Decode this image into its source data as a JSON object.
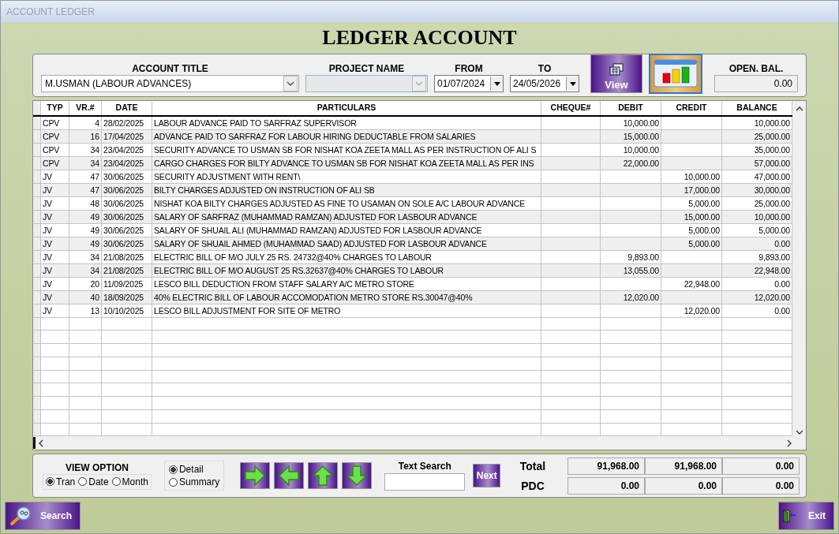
{
  "window": {
    "title": "ACCOUNT LEDGER"
  },
  "heading": "LEDGER ACCOUNT",
  "filters": {
    "account_title": {
      "label": "ACCOUNT TITLE",
      "value": "M.USMAN (LABOUR ADVANCES)"
    },
    "project_name": {
      "label": "PROJECT NAME",
      "disabled": true
    },
    "from": {
      "label": "FROM",
      "value": "01/07/2024"
    },
    "to": {
      "label": "TO",
      "value": "24/05/2026"
    },
    "view_button": "View",
    "opening_balance": {
      "label": "OPEN. BAL.",
      "value": "0.00"
    }
  },
  "table": {
    "columns": [
      "TYP",
      "VR.#",
      "DATE",
      "PARTICULARS",
      "CHEQUE#",
      "DEBIT",
      "CREDIT",
      "BALANCE"
    ],
    "rows": [
      {
        "typ": "CPV",
        "vr": "4",
        "date": "28/02/2025",
        "particulars": "LABOUR ADVANCE PAID TO SARFRAZ SUPERVISOR",
        "debit": "10,000.00",
        "balance": "10,000.00"
      },
      {
        "typ": "CPV",
        "vr": "16",
        "date": "17/04/2025",
        "particulars": "ADVANCE PAID TO SARFRAZ FOR LABOUR HIRING DEDUCTABLE FROM SALARIES",
        "debit": "15,000.00",
        "balance": "25,000.00"
      },
      {
        "typ": "CPV",
        "vr": "34",
        "date": "23/04/2025",
        "particulars": "SECURITY ADVANCE TO USMAN SB FOR NISHAT KOA ZEETA MALL AS PER INSTRUCTION OF ALI S",
        "debit": "10,000.00",
        "balance": "35,000.00"
      },
      {
        "typ": "CPV",
        "vr": "34",
        "date": "23/04/2025",
        "particulars": "CARGO CHARGES FOR BILTY ADVANCE TO USMAN SB FOR NISHAT KOA ZEETA MALL AS PER INS",
        "debit": "22,000.00",
        "balance": "57,000.00"
      },
      {
        "typ": "JV",
        "vr": "47",
        "date": "30/06/2025",
        "particulars": "SECURITY ADJUSTMENT WITH RENT\\",
        "credit": "10,000.00",
        "balance": "47,000.00"
      },
      {
        "typ": "JV",
        "vr": "47",
        "date": "30/06/2025",
        "particulars": "BILTY CHARGES ADJUSTED ON INSTRUCTION OF ALI SB",
        "credit": "17,000.00",
        "balance": "30,000.00"
      },
      {
        "typ": "JV",
        "vr": "48",
        "date": "30/06/2025",
        "particulars": "NISHAT KOA BILTY CHARGES ADJUSTED AS FINE TO USAMAN ON SOLE A/C LABOUR ADVANCE",
        "credit": "5,000.00",
        "balance": "25,000.00"
      },
      {
        "typ": "JV",
        "vr": "49",
        "date": "30/06/2025",
        "particulars": "SALARY OF SARFRAZ (MUHAMMAD RAMZAN) ADJUSTED FOR LASBOUR ADVANCE",
        "credit": "15,000.00",
        "balance": "10,000.00"
      },
      {
        "typ": "JV",
        "vr": "49",
        "date": "30/06/2025",
        "particulars": "SALARY OF SHUAIL ALI (MUHAMMAD RAMZAN)  ADJUSTED FOR LASBOUR ADVANCE",
        "credit": "5,000.00",
        "balance": "5,000.00"
      },
      {
        "typ": "JV",
        "vr": "49",
        "date": "30/06/2025",
        "particulars": "SALARY OF SHUAIL AHMED (MUHAMMAD SAAD) ADJUSTED FOR LASBOUR ADVANCE",
        "credit": "5,000.00",
        "balance": "0.00"
      },
      {
        "typ": "JV",
        "vr": "34",
        "date": "21/08/2025",
        "particulars": "ELECTRIC BILL OF M/O JULY 25 RS. 24732@40% CHARGES TO LABOUR",
        "debit": "9,893.00",
        "balance": "9,893.00"
      },
      {
        "typ": "JV",
        "vr": "34",
        "date": "21/08/2025",
        "particulars": "ELECTRIC BILL OF M/O AUGUST 25 RS.32637@40% CHARGES TO LABOUR",
        "debit": "13,055.00",
        "balance": "22,948.00"
      },
      {
        "typ": "JV",
        "vr": "20",
        "date": "11/09/2025",
        "particulars": "LESCO BILL DEDUCTION FROM STAFF SALARY A/C METRO STORE",
        "credit": "22,948.00",
        "balance": "0.00"
      },
      {
        "typ": "JV",
        "vr": "40",
        "date": "18/09/2025",
        "particulars": "40% ELECTRIC BILL OF LABOUR ACCOMODATION METRO STORE RS.30047@40%",
        "debit": "12,020.00",
        "balance": "12,020.00"
      },
      {
        "typ": "JV",
        "vr": "13",
        "date": "10/10/2025",
        "particulars": "LESCO BILL ADJUSTMENT FOR SITE OF METRO",
        "credit": "12,020.00",
        "balance": "0.00"
      }
    ]
  },
  "view_option": {
    "label": "VIEW OPTION",
    "options": [
      {
        "label": "Tran",
        "selected": true
      },
      {
        "label": "Date",
        "selected": false
      },
      {
        "label": "Month",
        "selected": false
      }
    ]
  },
  "detail_option": [
    {
      "label": "Detail",
      "selected": true
    },
    {
      "label": "Summary",
      "selected": false
    }
  ],
  "text_search": {
    "label": "Text Search"
  },
  "next_button": "Next",
  "totals": [
    {
      "label": "Total",
      "values": [
        "91,968.00",
        "91,968.00",
        "0.00"
      ]
    },
    {
      "label": "PDC",
      "values": [
        "0.00",
        "0.00",
        "0.00"
      ]
    }
  ],
  "search_button": "Search",
  "exit_button": "Exit"
}
